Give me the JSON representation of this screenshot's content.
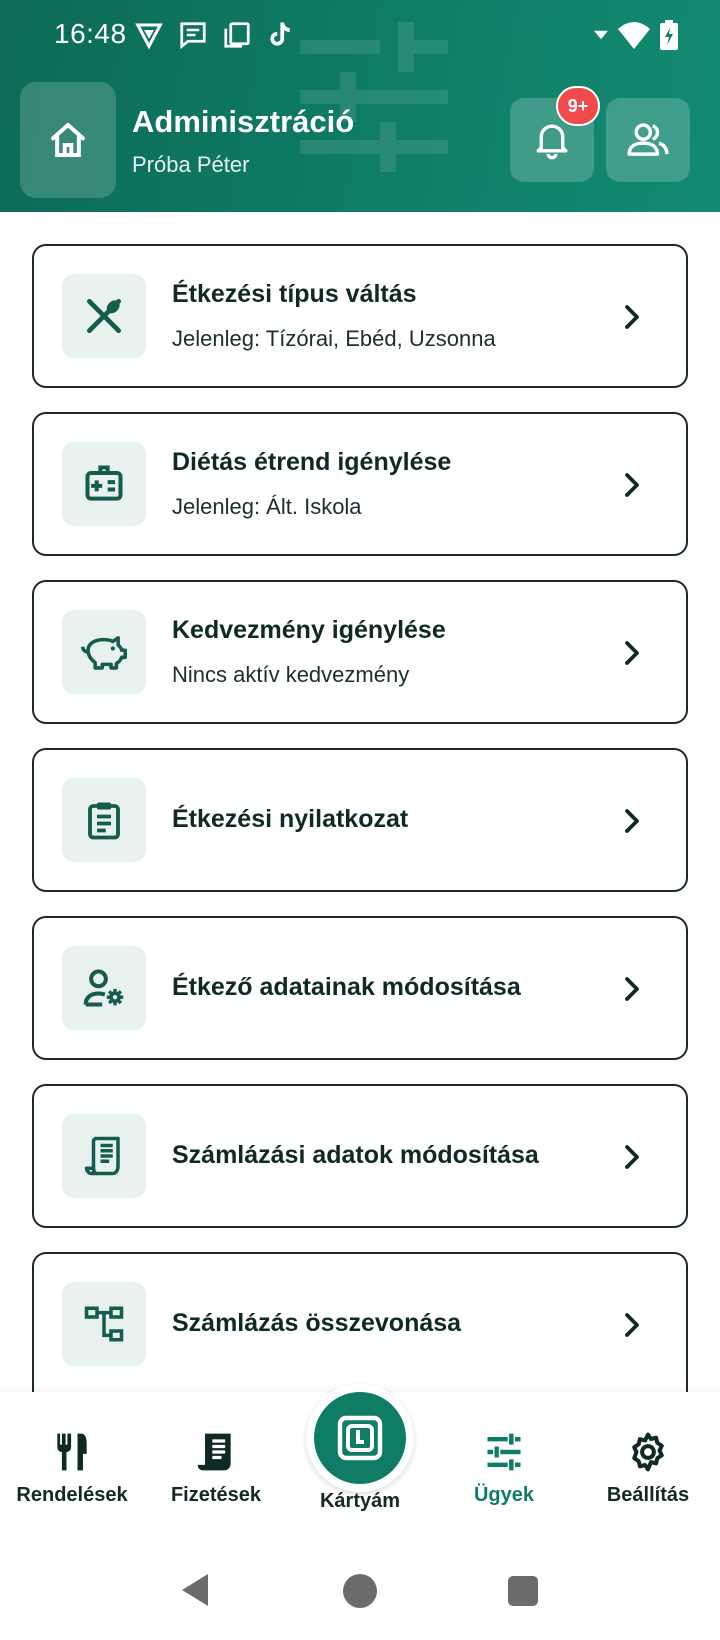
{
  "status_bar": {
    "time": "16:48"
  },
  "header": {
    "title": "Adminisztráció",
    "subtitle": "Próba Péter",
    "notification_badge": "9+"
  },
  "cards": [
    {
      "title": "Étkezési típus váltás",
      "subtitle": "Jelenleg: Tízórai, Ebéd, Uzsonna",
      "icon": "utensils-icon"
    },
    {
      "title": "Diétás étrend igénylése",
      "subtitle": "Jelenleg: Ált. Iskola",
      "icon": "medical-id-icon"
    },
    {
      "title": "Kedvezmény igénylése",
      "subtitle": "Nincs aktív kedvezmény",
      "icon": "piggy-bank-icon"
    },
    {
      "title": "Étkezési nyilatkozat",
      "icon": "clipboard-icon"
    },
    {
      "title": "Étkező adatainak módosítása",
      "icon": "user-settings-icon"
    },
    {
      "title": "Számlázási adatok módosítása",
      "icon": "receipt-icon"
    },
    {
      "title": "Számlázás összevonása",
      "icon": "merge-tree-icon"
    }
  ],
  "bottom_nav": {
    "items": [
      {
        "label": "Rendelések",
        "icon": "fork-knife-icon"
      },
      {
        "label": "Fizetések",
        "icon": "receipt-icon"
      },
      {
        "label": "Kártyám",
        "icon": "card-icon"
      },
      {
        "label": "Ügyek",
        "icon": "sliders-icon",
        "active": true
      },
      {
        "label": "Beállítás",
        "icon": "gear-icon"
      }
    ]
  },
  "colors": {
    "primary": "#0f7d66",
    "badge": "#ef4b4b",
    "icon_bg": "#e8f1ee"
  }
}
